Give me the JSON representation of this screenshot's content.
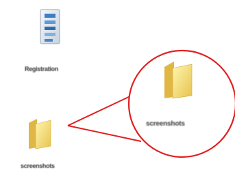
{
  "desktop": {
    "icons": [
      {
        "label": "Registration",
        "icon": "registry-editor-icon"
      },
      {
        "label": "screenshots",
        "icon": "folder-icon"
      }
    ],
    "magnifier": {
      "label": "screenshots",
      "icon": "folder-icon",
      "color": "#e02020"
    }
  }
}
